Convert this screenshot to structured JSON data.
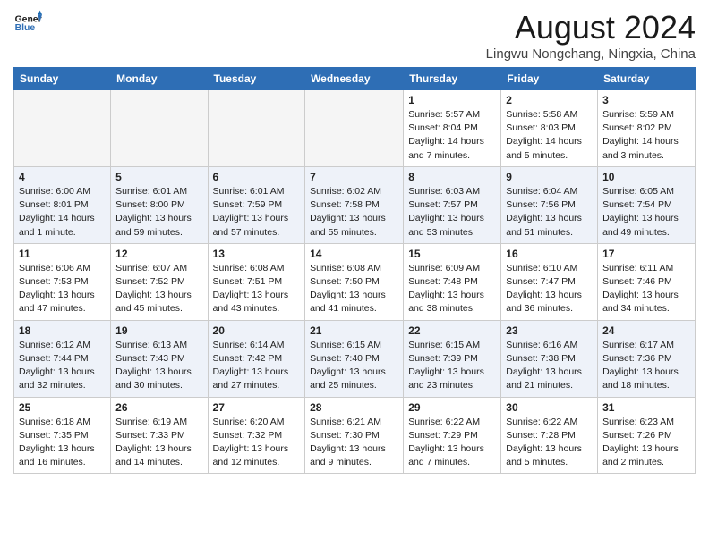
{
  "header": {
    "logo_line1": "General",
    "logo_line2": "Blue",
    "month": "August 2024",
    "location": "Lingwu Nongchang, Ningxia, China"
  },
  "weekdays": [
    "Sunday",
    "Monday",
    "Tuesday",
    "Wednesday",
    "Thursday",
    "Friday",
    "Saturday"
  ],
  "weeks": [
    [
      {
        "day": "",
        "sunrise": "",
        "sunset": "",
        "daylight": ""
      },
      {
        "day": "",
        "sunrise": "",
        "sunset": "",
        "daylight": ""
      },
      {
        "day": "",
        "sunrise": "",
        "sunset": "",
        "daylight": ""
      },
      {
        "day": "",
        "sunrise": "",
        "sunset": "",
        "daylight": ""
      },
      {
        "day": "1",
        "sunrise": "Sunrise: 5:57 AM",
        "sunset": "Sunset: 8:04 PM",
        "daylight": "Daylight: 14 hours and 7 minutes."
      },
      {
        "day": "2",
        "sunrise": "Sunrise: 5:58 AM",
        "sunset": "Sunset: 8:03 PM",
        "daylight": "Daylight: 14 hours and 5 minutes."
      },
      {
        "day": "3",
        "sunrise": "Sunrise: 5:59 AM",
        "sunset": "Sunset: 8:02 PM",
        "daylight": "Daylight: 14 hours and 3 minutes."
      }
    ],
    [
      {
        "day": "4",
        "sunrise": "Sunrise: 6:00 AM",
        "sunset": "Sunset: 8:01 PM",
        "daylight": "Daylight: 14 hours and 1 minute."
      },
      {
        "day": "5",
        "sunrise": "Sunrise: 6:01 AM",
        "sunset": "Sunset: 8:00 PM",
        "daylight": "Daylight: 13 hours and 59 minutes."
      },
      {
        "day": "6",
        "sunrise": "Sunrise: 6:01 AM",
        "sunset": "Sunset: 7:59 PM",
        "daylight": "Daylight: 13 hours and 57 minutes."
      },
      {
        "day": "7",
        "sunrise": "Sunrise: 6:02 AM",
        "sunset": "Sunset: 7:58 PM",
        "daylight": "Daylight: 13 hours and 55 minutes."
      },
      {
        "day": "8",
        "sunrise": "Sunrise: 6:03 AM",
        "sunset": "Sunset: 7:57 PM",
        "daylight": "Daylight: 13 hours and 53 minutes."
      },
      {
        "day": "9",
        "sunrise": "Sunrise: 6:04 AM",
        "sunset": "Sunset: 7:56 PM",
        "daylight": "Daylight: 13 hours and 51 minutes."
      },
      {
        "day": "10",
        "sunrise": "Sunrise: 6:05 AM",
        "sunset": "Sunset: 7:54 PM",
        "daylight": "Daylight: 13 hours and 49 minutes."
      }
    ],
    [
      {
        "day": "11",
        "sunrise": "Sunrise: 6:06 AM",
        "sunset": "Sunset: 7:53 PM",
        "daylight": "Daylight: 13 hours and 47 minutes."
      },
      {
        "day": "12",
        "sunrise": "Sunrise: 6:07 AM",
        "sunset": "Sunset: 7:52 PM",
        "daylight": "Daylight: 13 hours and 45 minutes."
      },
      {
        "day": "13",
        "sunrise": "Sunrise: 6:08 AM",
        "sunset": "Sunset: 7:51 PM",
        "daylight": "Daylight: 13 hours and 43 minutes."
      },
      {
        "day": "14",
        "sunrise": "Sunrise: 6:08 AM",
        "sunset": "Sunset: 7:50 PM",
        "daylight": "Daylight: 13 hours and 41 minutes."
      },
      {
        "day": "15",
        "sunrise": "Sunrise: 6:09 AM",
        "sunset": "Sunset: 7:48 PM",
        "daylight": "Daylight: 13 hours and 38 minutes."
      },
      {
        "day": "16",
        "sunrise": "Sunrise: 6:10 AM",
        "sunset": "Sunset: 7:47 PM",
        "daylight": "Daylight: 13 hours and 36 minutes."
      },
      {
        "day": "17",
        "sunrise": "Sunrise: 6:11 AM",
        "sunset": "Sunset: 7:46 PM",
        "daylight": "Daylight: 13 hours and 34 minutes."
      }
    ],
    [
      {
        "day": "18",
        "sunrise": "Sunrise: 6:12 AM",
        "sunset": "Sunset: 7:44 PM",
        "daylight": "Daylight: 13 hours and 32 minutes."
      },
      {
        "day": "19",
        "sunrise": "Sunrise: 6:13 AM",
        "sunset": "Sunset: 7:43 PM",
        "daylight": "Daylight: 13 hours and 30 minutes."
      },
      {
        "day": "20",
        "sunrise": "Sunrise: 6:14 AM",
        "sunset": "Sunset: 7:42 PM",
        "daylight": "Daylight: 13 hours and 27 minutes."
      },
      {
        "day": "21",
        "sunrise": "Sunrise: 6:15 AM",
        "sunset": "Sunset: 7:40 PM",
        "daylight": "Daylight: 13 hours and 25 minutes."
      },
      {
        "day": "22",
        "sunrise": "Sunrise: 6:15 AM",
        "sunset": "Sunset: 7:39 PM",
        "daylight": "Daylight: 13 hours and 23 minutes."
      },
      {
        "day": "23",
        "sunrise": "Sunrise: 6:16 AM",
        "sunset": "Sunset: 7:38 PM",
        "daylight": "Daylight: 13 hours and 21 minutes."
      },
      {
        "day": "24",
        "sunrise": "Sunrise: 6:17 AM",
        "sunset": "Sunset: 7:36 PM",
        "daylight": "Daylight: 13 hours and 18 minutes."
      }
    ],
    [
      {
        "day": "25",
        "sunrise": "Sunrise: 6:18 AM",
        "sunset": "Sunset: 7:35 PM",
        "daylight": "Daylight: 13 hours and 16 minutes."
      },
      {
        "day": "26",
        "sunrise": "Sunrise: 6:19 AM",
        "sunset": "Sunset: 7:33 PM",
        "daylight": "Daylight: 13 hours and 14 minutes."
      },
      {
        "day": "27",
        "sunrise": "Sunrise: 6:20 AM",
        "sunset": "Sunset: 7:32 PM",
        "daylight": "Daylight: 13 hours and 12 minutes."
      },
      {
        "day": "28",
        "sunrise": "Sunrise: 6:21 AM",
        "sunset": "Sunset: 7:30 PM",
        "daylight": "Daylight: 13 hours and 9 minutes."
      },
      {
        "day": "29",
        "sunrise": "Sunrise: 6:22 AM",
        "sunset": "Sunset: 7:29 PM",
        "daylight": "Daylight: 13 hours and 7 minutes."
      },
      {
        "day": "30",
        "sunrise": "Sunrise: 6:22 AM",
        "sunset": "Sunset: 7:28 PM",
        "daylight": "Daylight: 13 hours and 5 minutes."
      },
      {
        "day": "31",
        "sunrise": "Sunrise: 6:23 AM",
        "sunset": "Sunset: 7:26 PM",
        "daylight": "Daylight: 13 hours and 2 minutes."
      }
    ]
  ]
}
